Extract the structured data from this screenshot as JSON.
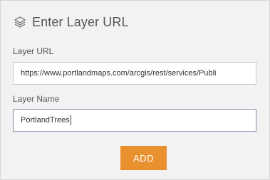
{
  "dialog": {
    "title": "Enter Layer URL",
    "icon": "layers-icon"
  },
  "fields": {
    "url_label": "Layer URL",
    "url_value": "https://www.portlandmaps.com/arcgis/rest/services/Publi",
    "name_label": "Layer Name",
    "name_value": "PortlandTrees"
  },
  "actions": {
    "add_label": "ADD"
  },
  "colors": {
    "accent": "#e8912e",
    "background": "#f2f2f2",
    "focus_border": "#7a8fa6"
  }
}
